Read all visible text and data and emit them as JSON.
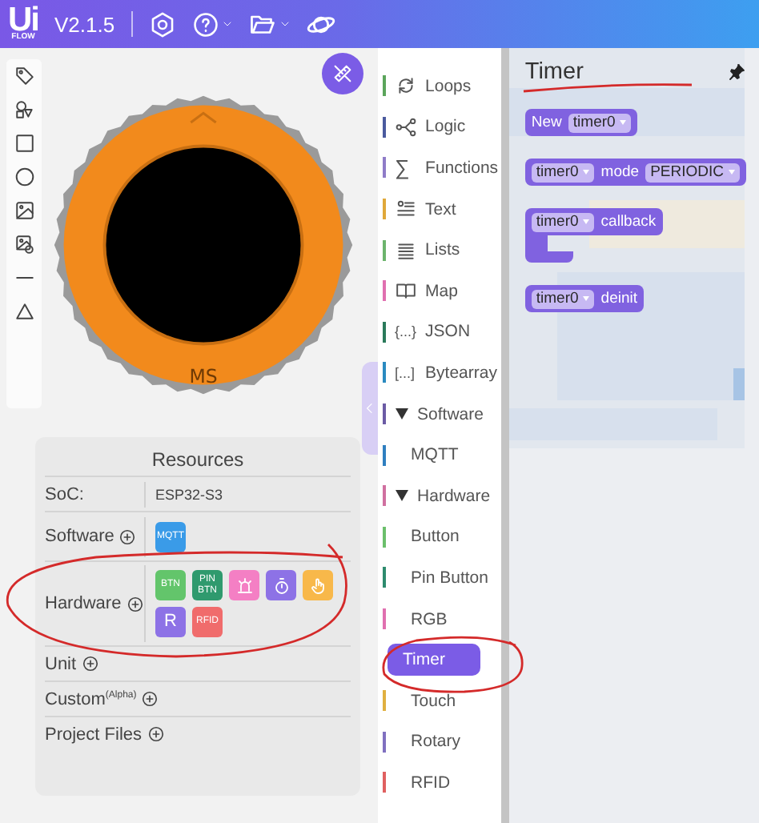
{
  "header": {
    "logo": "Ui",
    "logo_sub": "FLOW",
    "version": "V2.1.5"
  },
  "device": {
    "label": "MS"
  },
  "resources": {
    "title": "Resources",
    "rows": [
      {
        "kind": "soc",
        "label": "SoC:",
        "value": "ESP32-S3"
      },
      {
        "kind": "add",
        "label": "Software",
        "chips": [
          {
            "kind": "text",
            "text": "MQTT",
            "color": "#3a9be8"
          }
        ]
      },
      {
        "kind": "add",
        "label": "Hardware",
        "chips": [
          {
            "kind": "text",
            "text": "BTN",
            "color": "#63c56b"
          },
          {
            "kind": "text",
            "text": "PIN BTN",
            "color": "#2f9a6e"
          },
          {
            "kind": "rgb",
            "color": "#f47fc4"
          },
          {
            "kind": "timer",
            "color": "#8d72e6"
          },
          {
            "kind": "touch",
            "color": "#f8b84a"
          },
          {
            "kind": "big",
            "text": "R",
            "color": "#8d72e6"
          },
          {
            "kind": "text",
            "text": "RFID",
            "color": "#f06c6c"
          }
        ]
      },
      {
        "kind": "add",
        "label": "Unit"
      },
      {
        "kind": "add",
        "label": "Custom$^{(Alpha)}$"
      },
      {
        "kind": "add",
        "label": "Project Files"
      }
    ]
  },
  "categories": [
    {
      "kind": "category",
      "label": "Loops",
      "color": "#5ba55b"
    },
    {
      "kind": "category",
      "label": "Logic",
      "color": "#4a5a9e"
    },
    {
      "kind": "category",
      "label": "Functions",
      "icon_text": "∑",
      "color": "#8f7cc8"
    },
    {
      "kind": "category",
      "label": "Text",
      "color": "#e0a83a"
    },
    {
      "kind": "category",
      "label": "Lists",
      "color": "#6cb46c"
    },
    {
      "kind": "category",
      "label": "Map",
      "color": "#e070b0"
    },
    {
      "kind": "category",
      "label": "JSON",
      "icon_text": "{...}",
      "color": "#2a7a5a"
    },
    {
      "kind": "category",
      "label": "Bytearray",
      "icon_text": "[...]",
      "color": "#2a8ac0"
    },
    {
      "kind": "group",
      "label": "Software",
      "expanded": true,
      "color": "#6b5ba5",
      "children": [
        {
          "label": "MQTT",
          "color": "#2f7fc0",
          "selected": false
        }
      ]
    },
    {
      "kind": "group",
      "label": "Hardware",
      "expanded": true,
      "color": "#d070a0",
      "children": [
        {
          "label": "Button",
          "color": "#6bbf6b",
          "selected": false
        },
        {
          "label": "Pin Button",
          "color": "#2e8b6e",
          "selected": false
        },
        {
          "label": "RGB",
          "color": "#e070b0",
          "selected": false
        },
        {
          "label": "Timer",
          "color": "#7b5ce6",
          "selected": true
        },
        {
          "label": "Touch",
          "color": "#e0b040",
          "selected": false
        },
        {
          "label": "Rotary",
          "color": "#8070c0",
          "selected": false
        },
        {
          "label": "RFID",
          "color": "#e06060",
          "selected": false
        }
      ]
    }
  ],
  "flyout": {
    "title": "Timer",
    "blocks": [
      {
        "kind": "plain",
        "parts": [
          {
            "kind": "text",
            "text": "New"
          },
          {
            "kind": "dropdown",
            "text": "timer0"
          }
        ]
      },
      {
        "kind": "plain",
        "parts": [
          {
            "kind": "dropdown",
            "text": "timer0"
          },
          {
            "kind": "text",
            "text": "mode"
          },
          {
            "kind": "dropdown",
            "text": "PERIODIC"
          }
        ]
      },
      {
        "kind": "statement",
        "parts": [
          {
            "kind": "dropdown",
            "text": "timer0"
          },
          {
            "kind": "text",
            "text": "callback"
          }
        ]
      },
      {
        "kind": "plain",
        "parts": [
          {
            "kind": "dropdown",
            "text": "timer0"
          },
          {
            "kind": "text",
            "text": "deinit"
          }
        ]
      }
    ]
  }
}
